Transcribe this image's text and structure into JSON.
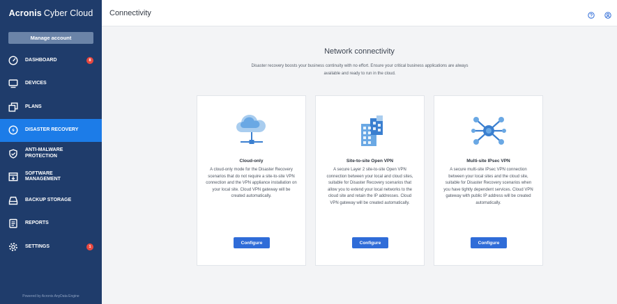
{
  "brand": {
    "bold": "Acronis",
    "light": "Cyber Cloud"
  },
  "sidebar": {
    "manage_label": "Manage account",
    "items": [
      {
        "label": "DASHBOARD",
        "icon": "speedometer-icon",
        "badge": "8",
        "active": false
      },
      {
        "label": "DEVICES",
        "icon": "monitor-icon",
        "badge": "",
        "active": false
      },
      {
        "label": "PLANS",
        "icon": "plans-icon",
        "badge": "",
        "active": false
      },
      {
        "label": "DISASTER RECOVERY",
        "icon": "disaster-recovery-icon",
        "badge": "",
        "active": true
      },
      {
        "label": "ANTI-MALWARE PROTECTION",
        "icon": "shield-icon",
        "badge": "",
        "active": false
      },
      {
        "label": "SOFTWARE MANAGEMENT",
        "icon": "software-icon",
        "badge": "",
        "active": false
      },
      {
        "label": "BACKUP STORAGE",
        "icon": "storage-icon",
        "badge": "",
        "active": false
      },
      {
        "label": "REPORTS",
        "icon": "report-icon",
        "badge": "",
        "active": false
      },
      {
        "label": "SETTINGS",
        "icon": "gear-icon",
        "badge": "1",
        "active": false
      }
    ],
    "powered": "Powered by Acronis AnyData Engine"
  },
  "header": {
    "title": "Connectivity"
  },
  "main": {
    "title": "Network connectivity",
    "description": "Disaster recovery boosts your business continuity with no effort. Ensure your critical business applications are always available and ready to run in the cloud.",
    "cards": [
      {
        "title": "Cloud-only",
        "description": "A cloud-only mode for the Disaster Recovery scenarios that do not require a site-to-site VPN connection and the VPN appliance installation on your local site. Cloud VPN gateway will be created automatically.",
        "button": "Configure"
      },
      {
        "title": "Site-to-site Open VPN",
        "description": "A secure Layer 2 site-to-site Open VPN connection between your local and cloud sites, suitable for Disaster Recovery scenarios that allow you to extend your local networks to the cloud site and retain the IP addresses. Cloud VPN gateway will be created automatically.",
        "button": "Configure"
      },
      {
        "title": "Multi-site IPsec VPN",
        "description": "A secure multi-site IPsec VPN connection between your local sites and the cloud site, suitable for Disaster Recovery scenarios when you have tightly dependent services. Cloud VPN gateway with public IP address will be created automatically.",
        "button": "Configure"
      }
    ]
  },
  "colors": {
    "sidebar": "#1f3c6b",
    "active": "#1c7ce8",
    "button": "#2f6cd8",
    "badge": "#e8483f",
    "background": "#f3f4f6"
  }
}
